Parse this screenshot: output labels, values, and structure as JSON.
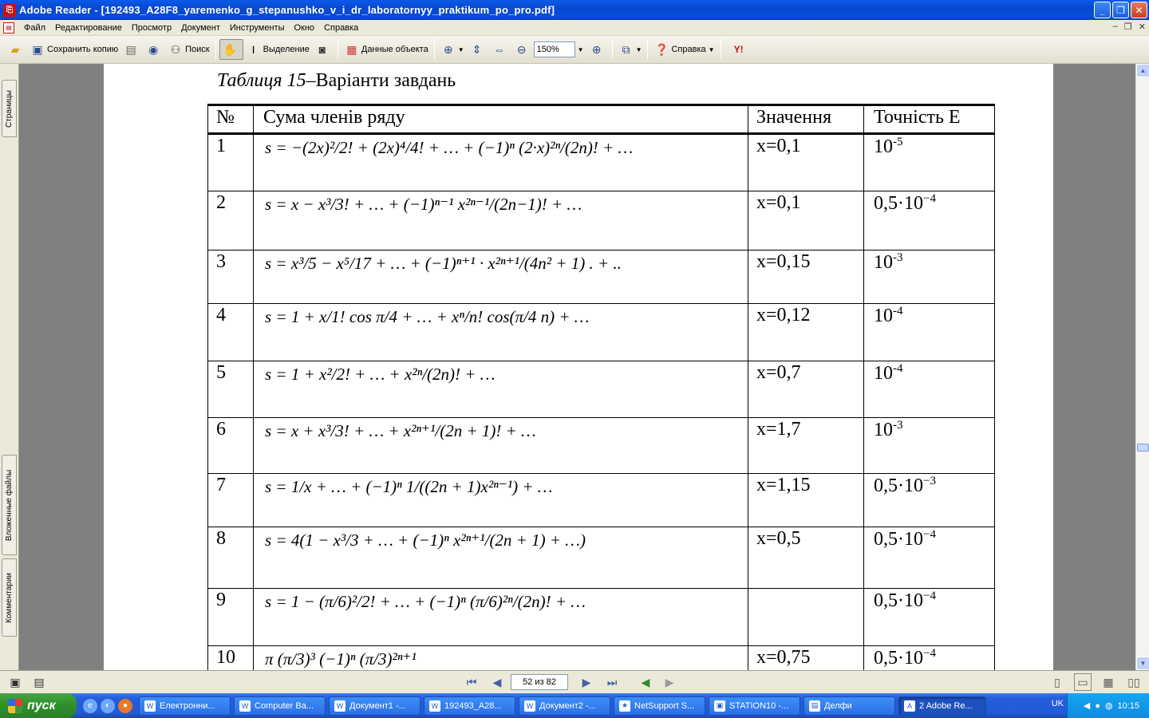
{
  "window": {
    "title": "Adobe Reader - [192493_A28F8_yaremenko_g_stepanushko_v_i_dr_laboratornyy_praktikum_po_pro.pdf]",
    "app_icon": "adobe-icon"
  },
  "menu": {
    "items": [
      "Файл",
      "Редактирование",
      "Просмотр",
      "Документ",
      "Инструменты",
      "Окно",
      "Справка"
    ]
  },
  "toolbar": {
    "save_copy": "Сохранить копию",
    "search": "Поиск",
    "select": "Выделение",
    "object_data": "Данные объекта",
    "zoom_value": "150%",
    "help": "Справка"
  },
  "sidebar": {
    "pages_tab": "Страницы",
    "attachments_tab": "Вложенные файлы",
    "comments_tab": "Комментарии"
  },
  "document": {
    "caption_italic": "Таблиця 15",
    "caption_rest": "–Варіанти завдань",
    "headers": [
      "№",
      "Сума членів ряду",
      "Значення",
      "Точність Е"
    ],
    "rows": [
      {
        "num": "1",
        "formula": "s = −(2x)²/2! + (2x)⁴/4! + … + (−1)ⁿ (2·x)²ⁿ/(2n)! + …",
        "value": "x=0,1",
        "acc_base": "10",
        "acc_exp": "-5"
      },
      {
        "num": "2",
        "formula": "s = x − x³/3! + … + (−1)ⁿ⁻¹ x²ⁿ⁻¹/(2n−1)! + …",
        "value": "x=0,1",
        "acc_base": "0,5·10",
        "acc_exp": "−4"
      },
      {
        "num": "3",
        "formula": "s = x³/5 − x⁵/17 + … + (−1)ⁿ⁺¹ · x²ⁿ⁺¹/(4n² + 1) . + ..",
        "value": "x=0,15",
        "acc_base": "10",
        "acc_exp": "-3"
      },
      {
        "num": "4",
        "formula": "s = 1 + x/1! cos π/4 + … + xⁿ/n! cos(π/4 n) + …",
        "value": "x=0,12",
        "acc_base": "10",
        "acc_exp": "-4"
      },
      {
        "num": "5",
        "formula": "s = 1 + x²/2! + … + x²ⁿ/(2n)! + …",
        "value": "x=0,7",
        "acc_base": "10",
        "acc_exp": "-4"
      },
      {
        "num": "6",
        "formula": "s = x + x³/3! + … + x²ⁿ⁺¹/(2n + 1)! + …",
        "value": "x=1,7",
        "acc_base": "10",
        "acc_exp": "-3"
      },
      {
        "num": "7",
        "formula": "s = 1/x + … + (−1)ⁿ 1/((2n + 1)x²ⁿ⁻¹) + …",
        "value": "x=1,15",
        "acc_base": "0,5·10",
        "acc_exp": "−3"
      },
      {
        "num": "8",
        "formula": "s = 4(1 − x³/3 + … + (−1)ⁿ x²ⁿ⁺¹/(2n + 1) + …)",
        "value": "x=0,5",
        "acc_base": "0,5·10",
        "acc_exp": "−4"
      },
      {
        "num": "9",
        "formula": "s = 1 − (π/6)²/2! + … + (−1)ⁿ (π/6)²ⁿ/(2n)! + …",
        "value": "",
        "acc_base": "0,5·10",
        "acc_exp": "−4"
      },
      {
        "num": "10",
        "formula": "π   (π/3)³   (−1)ⁿ (π/3)²ⁿ⁺¹",
        "value": "x=0,75",
        "acc_base": "0,5·10",
        "acc_exp": "−4"
      }
    ]
  },
  "statusbar": {
    "page_indicator": "52 из 82"
  },
  "taskbar": {
    "start": "пуск",
    "tasks": [
      {
        "label": "Електронни...",
        "icon": "W",
        "active": false
      },
      {
        "label": "Computer Ba...",
        "icon": "W",
        "active": false
      },
      {
        "label": "Документ1 -...",
        "icon": "W",
        "active": false
      },
      {
        "label": "192493_A28...",
        "icon": "W",
        "active": false
      },
      {
        "label": "Документ2 -...",
        "icon": "W",
        "active": false
      },
      {
        "label": "NetSupport S...",
        "icon": "★",
        "active": false
      },
      {
        "label": "STATION10 -...",
        "icon": "▣",
        "active": false
      },
      {
        "label": "Делфи",
        "icon": "▤",
        "active": false
      },
      {
        "label": "2 Adobe Re...",
        "icon": "A",
        "active": true
      }
    ],
    "lang": "UK",
    "clock": "10:15"
  }
}
